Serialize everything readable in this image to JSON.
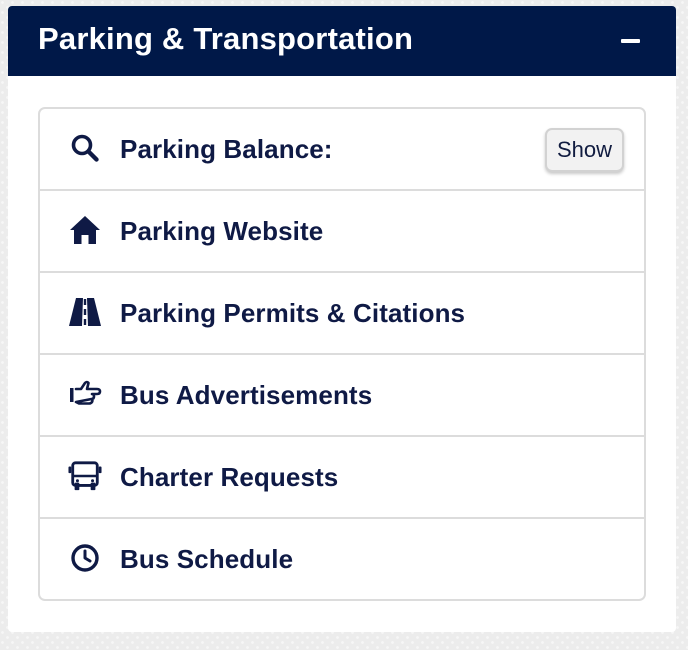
{
  "panel": {
    "title": "Parking & Transportation",
    "collapse_icon": "minus-icon"
  },
  "items": [
    {
      "label": "Parking Balance:",
      "icon": "search-icon",
      "action_label": "Show"
    },
    {
      "label": "Parking Website",
      "icon": "home-icon"
    },
    {
      "label": "Parking Permits & Citations",
      "icon": "road-icon"
    },
    {
      "label": "Bus Advertisements",
      "icon": "hand-pointing-icon"
    },
    {
      "label": "Charter Requests",
      "icon": "bus-icon"
    },
    {
      "label": "Bus Schedule",
      "icon": "clock-icon"
    }
  ],
  "colors": {
    "header_bg": "#001848",
    "text": "#0f1a45",
    "border": "#dcdcdc"
  }
}
